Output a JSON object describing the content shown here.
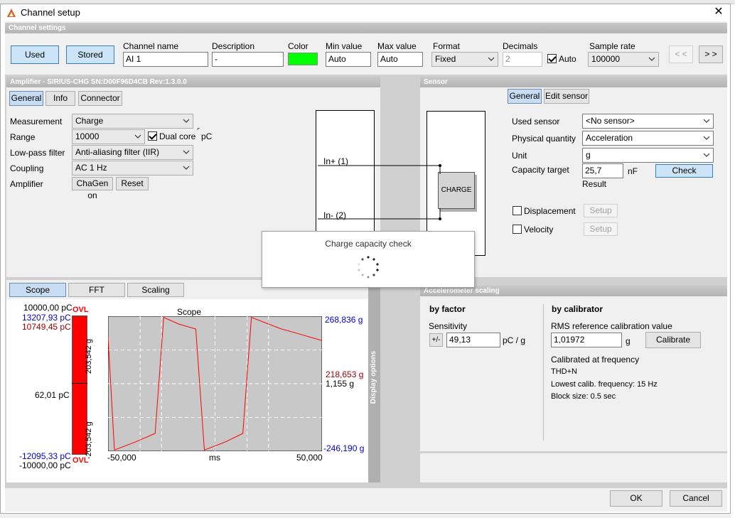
{
  "window": {
    "title": "Channel setup",
    "close_glyph": "✕"
  },
  "channel_settings": {
    "header": "Channel settings",
    "used_label": "Used",
    "stored_label": "Stored",
    "channel_name_label": "Channel name",
    "channel_name_value": "AI 1",
    "description_label": "Description",
    "description_value": "-",
    "color_label": "Color",
    "color_value": "#00ff00",
    "min_label": "Min value",
    "min_value": "Auto",
    "max_label": "Max value",
    "max_value": "Auto",
    "format_label": "Format",
    "format_value": "Fixed",
    "decimals_label": "Decimals",
    "decimals_value": "2",
    "auto_label": "Auto",
    "sample_rate_label": "Sample rate",
    "sample_rate_value": "100000",
    "prev_label": "< <",
    "next_label": "> >"
  },
  "amplifier": {
    "header": "Amplifier - SIRIUS-CHG  SN:D00F96D4CB Rev:1.3.0.0",
    "tabs": [
      "General",
      "Info",
      "Connector"
    ],
    "measurement_label": "Measurement",
    "measurement_value": "Charge",
    "range_label": "Range",
    "range_value": "10000",
    "dual_core_label": "Dual core",
    "unit_pc": "pC",
    "lowpass_label": "Low-pass filter",
    "lowpass_value": "Anti-aliasing filter (IIR)",
    "coupling_label": "Coupling",
    "coupling_value": "AC  1 Hz",
    "amplifier_label": "Amplifier",
    "chagen_label": "ChaGen on",
    "reset_label": "Reset",
    "in_plus": "In+ (1)",
    "in_minus": "In- (2)"
  },
  "sensor": {
    "header": "Sensor",
    "tabs": [
      "General",
      "Edit sensor"
    ],
    "charge_label": "CHARGE",
    "used_sensor_label": "Used sensor",
    "used_sensor_value": "<No sensor>",
    "physical_quantity_label": "Physical quantity",
    "physical_quantity_value": "Acceleration",
    "unit_label": "Unit",
    "unit_value": "g",
    "capacity_label": "Capacity target",
    "capacity_value": "25,7",
    "capacity_unit": "nF",
    "check_label": "Check",
    "result_label": "Result",
    "displacement_label": "Displacement",
    "velocity_label": "Velocity",
    "setup_label": "Setup"
  },
  "popup": {
    "title": "Charge capacity check"
  },
  "scope_tabs": [
    "Scope",
    "FFT",
    "Scaling"
  ],
  "scope": {
    "title": "Scope",
    "left_top": "10000,00 pC",
    "left_blue_top": "13207,93 pC",
    "left_red_top": "10749,45 pC",
    "left_mid": "62,01 pC",
    "left_blue_bottom": "-12095,33 pC",
    "left_bottom": "-10000,00 pC",
    "ovl": "OVL",
    "vert_top": "203,542 g",
    "vert_bottom": "-203,542 g",
    "right_top": "268,836 g",
    "right_red": "218,653 g",
    "right_mid": "1,155 g",
    "right_bottom": "-246,190 g",
    "x_left": "-50,000",
    "x_unit": "ms",
    "x_right": "50,000",
    "display_options": "Display options"
  },
  "chart_data": {
    "type": "line",
    "title": "Scope",
    "xlabel": "ms",
    "xlim": [
      -50,
      50
    ],
    "ylim": [
      -203.542,
      203.542
    ],
    "series": [
      {
        "values": [
          [
            -50,
            140
          ],
          [
            -47,
            -200
          ],
          [
            -37,
            -175
          ],
          [
            -28,
            -150
          ],
          [
            -24,
            200
          ],
          [
            -17,
            180
          ],
          [
            -9,
            165
          ],
          [
            -5,
            -200
          ],
          [
            5,
            -175
          ],
          [
            13,
            -150
          ],
          [
            17,
            200
          ],
          [
            25,
            180
          ],
          [
            31,
            165
          ],
          [
            34,
            160
          ],
          [
            50,
            130
          ]
        ]
      }
    ],
    "colors": {
      "trace": "#ff0000",
      "plot_bg": "#c8c8c8"
    }
  },
  "accel_scaling": {
    "header": "Accelerometer scaling",
    "by_factor": "by factor",
    "sensitivity_label": "Sensitivity",
    "sign_label": "+/-",
    "sensitivity_value": "49,13",
    "sensitivity_unit": "pC / g",
    "by_calibrator": "by calibrator",
    "rms_label": "RMS reference calibration value",
    "rms_value": "1,01972",
    "rms_unit": "g",
    "calibrate_label": "Calibrate",
    "calibrated_freq": "Calibrated at frequency",
    "thd": "THD+N",
    "lowest_calib": "Lowest calib. frequency: 15 Hz",
    "block_size": "Block size: 0.5 sec"
  },
  "footer": {
    "ok_label": "OK",
    "cancel_label": "Cancel"
  }
}
